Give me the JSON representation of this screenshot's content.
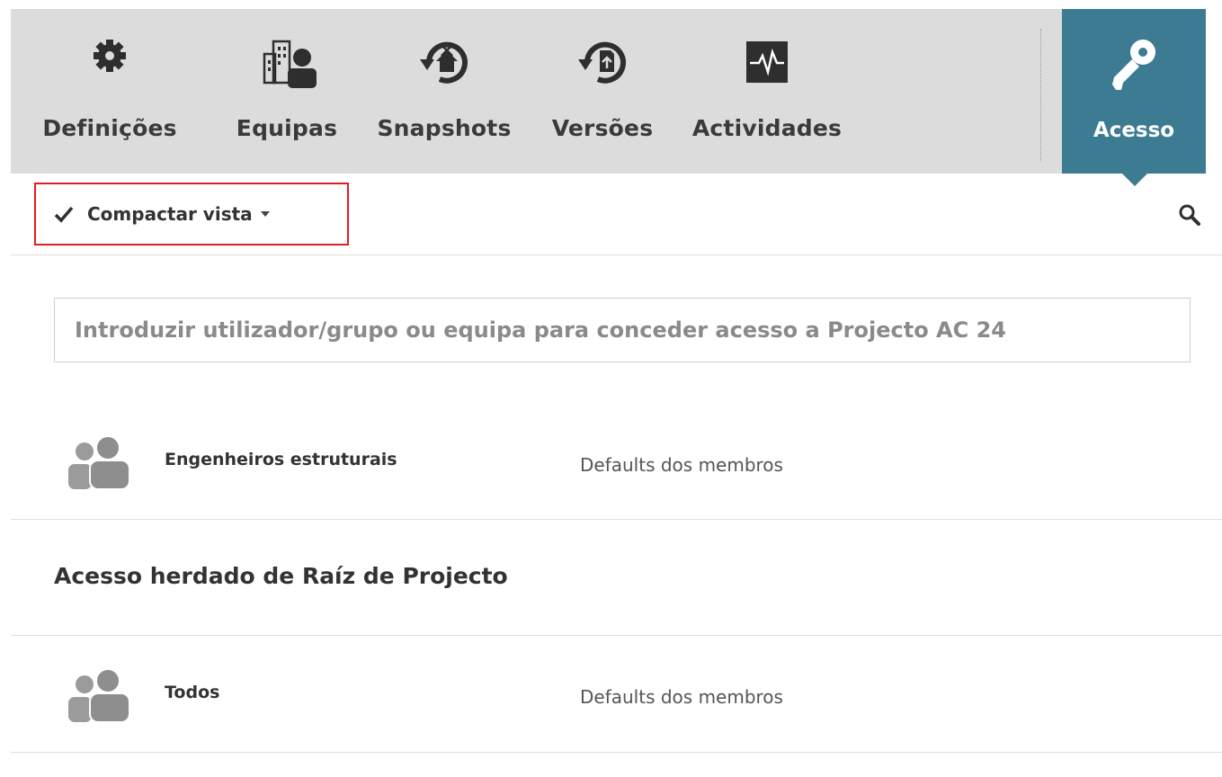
{
  "tabs": [
    {
      "label": "Definições",
      "icon": "gear-icon"
    },
    {
      "label": "Equipas",
      "icon": "team-building-icon"
    },
    {
      "label": "Snapshots",
      "icon": "snapshot-icon"
    },
    {
      "label": "Versões",
      "icon": "version-icon"
    },
    {
      "label": "Actividades",
      "icon": "activity-icon"
    }
  ],
  "active_tab": {
    "label": "Acesso",
    "icon": "key-icon"
  },
  "toolbar": {
    "view_label": "Compactar vista",
    "check_icon": "check-icon",
    "search_icon": "search-icon"
  },
  "grant_input": {
    "placeholder": "Introduzir utilizador/grupo ou equipa para conceder acesso a Projecto AC 24"
  },
  "direct_access": [
    {
      "name": "Engenheiros estruturais",
      "permission": "Defaults dos membros",
      "icon": "group-icon"
    }
  ],
  "inherited": {
    "title": "Acesso herdado de Raíz de Projecto",
    "rows": [
      {
        "name": "Todos",
        "permission": "Defaults dos membros",
        "icon": "group-icon"
      }
    ]
  },
  "colors": {
    "accent": "#3d7b93",
    "tabbar_bg": "#dcdcdc",
    "highlight_border": "#e02020"
  }
}
